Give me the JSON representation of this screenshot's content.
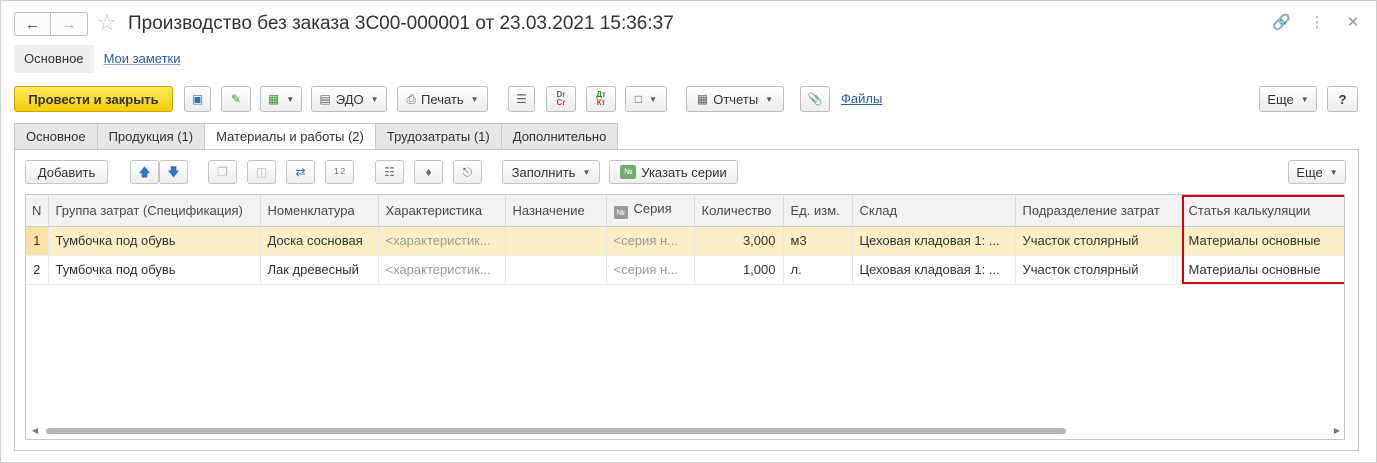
{
  "window": {
    "title": "Производство без заказа 3С00-000001 от 23.03.2021 15:36:37",
    "back_icon": "arrow-left-icon",
    "forward_icon": "arrow-right-icon"
  },
  "section_tabs": {
    "main": "Основное",
    "notes": "Мои заметки"
  },
  "toolbar": {
    "post_close": "Провести и закрыть",
    "edo": "ЭДО",
    "print": "Печать",
    "reports": "Отчеты",
    "files": "Файлы",
    "more": "Еще",
    "help": "?",
    "dt_a": "Dr",
    "dt_b": "Cr",
    "kt_a": "Дт",
    "kt_b": "Кт"
  },
  "doc_tabs": [
    "Основное",
    "Продукция (1)",
    "Материалы и работы (2)",
    "Трудозатраты (1)",
    "Дополнительно"
  ],
  "subtoolbar": {
    "add": "Добавить",
    "fill": "Заполнить",
    "series": "Указать серии",
    "series_badge": "№",
    "more": "Еще",
    "pick_num": "1 2"
  },
  "grid": {
    "columns": [
      "N",
      "Группа затрат (Спецификация)",
      "Номенклатура",
      "Характеристика",
      "Назначение",
      "Серия",
      "Количество",
      "Ед. изм.",
      "Склад",
      "Подразделение затрат",
      "Статья калькуляции"
    ],
    "series_badge": "№",
    "rows": [
      {
        "n": "1",
        "group": "Тумбочка под обувь",
        "item": "Доска сосновая",
        "characteristic": "<характеристик...",
        "purpose": "",
        "series": "<серия н...",
        "qty": "3,000",
        "unit": "м3",
        "warehouse": "Цеховая кладовая 1: ...",
        "department": "Участок столярный",
        "article": "Материалы основные"
      },
      {
        "n": "2",
        "group": "Тумбочка под обувь",
        "item": "Лак древесный",
        "characteristic": "<характеристик...",
        "purpose": "",
        "series": "<серия н...",
        "qty": "1,000",
        "unit": "л.",
        "warehouse": "Цеховая кладовая 1: ...",
        "department": "Участок столярный",
        "article": "Материалы основные"
      }
    ]
  },
  "colors": {
    "primary_button": "#f5d008",
    "selected_row": "#fbefc7",
    "highlight_border": "#d0021b",
    "link": "#2b5ca8"
  }
}
